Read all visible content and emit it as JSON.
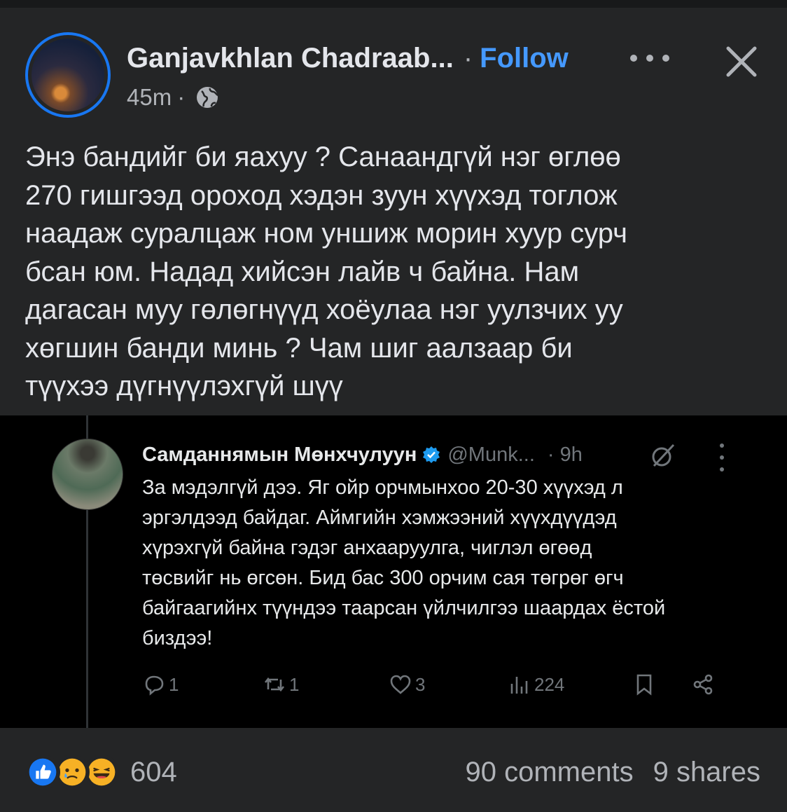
{
  "post": {
    "author": "Ganjavkhlan Chadraab...",
    "separator": "·",
    "follow_label": "Follow",
    "time": "45m",
    "meta_separator": "·",
    "audience_icon": "globe-icon",
    "text": "Энэ бандийг би яахуу ? Санаандгүй нэг өглөө\n270 гишгээд ороход хэдэн зуун хүүхэд тоглож\nнаадаж суралцаж ном уншиж морин хуур сурч\nбсан юм. Надад хийсэн лайв ч байна. Нам\nдагасан муу гөлөгнүүд хоёулаа нэг уулзчих уу\nхөгшин банди минь ? Чам шиг аалзаар би\nтүүхээ дүгнүүлэхгүй шүү"
  },
  "embed": {
    "name": "Самданнямын Мөнхчулуун",
    "handle": "@Munk...",
    "time": "· 9h",
    "text": "За мэдэлгүй дээ. Яг ойр орчмынхоо 20-30 хүүхэд л\nэргэлдээд байдаг. Аймгийн хэмжээний хүүхдүүдэд\nхүрэхгүй байна гэдэг анхааруулга, чиглэл өгөөд\nтөсвийг нь өгсөн. Бид бас 300 орчим сая төгрөг өгч\nбайгаагийнх түүндээ таарсан үйлчилгээ шаардах ёстой\nбиздээ!",
    "actions": {
      "replies": "1",
      "reposts": "1",
      "likes": "3",
      "views": "224"
    }
  },
  "footer": {
    "reaction_count": "604",
    "comments": "90 comments",
    "shares": "9 shares",
    "reaction_icons": [
      "like-icon",
      "sad-icon",
      "haha-icon"
    ]
  },
  "colors": {
    "background": "#242526",
    "accent": "#4599ff",
    "ring": "#1877f2",
    "secondary_text": "#b0b3b8"
  }
}
